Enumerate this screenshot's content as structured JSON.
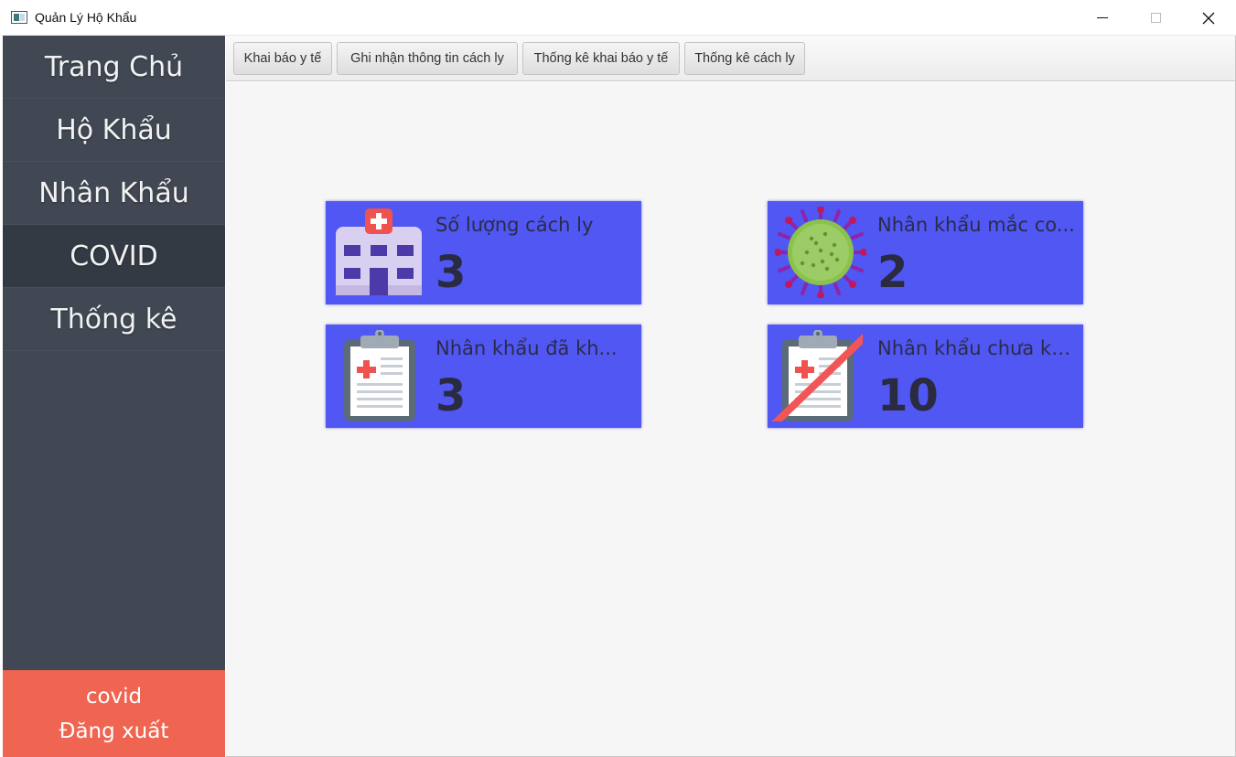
{
  "window": {
    "title": "Quản Lý Hộ Khẩu",
    "minimize_icon": "minimize-icon",
    "maximize_icon": "maximize-icon",
    "close_icon": "close-icon"
  },
  "sidebar": {
    "items": [
      {
        "label": "Trang Chủ"
      },
      {
        "label": "Hộ Khẩu"
      },
      {
        "label": "Nhân Khẩu"
      },
      {
        "label": "COVID",
        "active": true
      },
      {
        "label": "Thống kê"
      }
    ],
    "user": "covid",
    "logout_label": "Đăng xuất"
  },
  "toolbar": {
    "buttons": [
      {
        "label": "Khai báo y tế"
      },
      {
        "label": "Ghi nhận thông tin cách ly"
      },
      {
        "label": "Thống kê khai báo y tế"
      },
      {
        "label": "Thống kê cách ly"
      }
    ]
  },
  "cards": [
    {
      "label": "Số lượng cách ly",
      "value": "3",
      "icon": "hospital-icon"
    },
    {
      "label": "Nhân khẩu mắc co...",
      "value": "2",
      "icon": "virus-icon"
    },
    {
      "label": "Nhân khẩu đã kh...",
      "value": "3",
      "icon": "clipboard-medical-icon"
    },
    {
      "label": "Nhân khẩu chưa kha...",
      "value": "10",
      "icon": "clipboard-crossed-icon"
    }
  ],
  "colors": {
    "sidebar_bg": "#414854",
    "sidebar_active": "#343a43",
    "logout_bg": "#ef6552",
    "card_bg": "#5057f2"
  }
}
